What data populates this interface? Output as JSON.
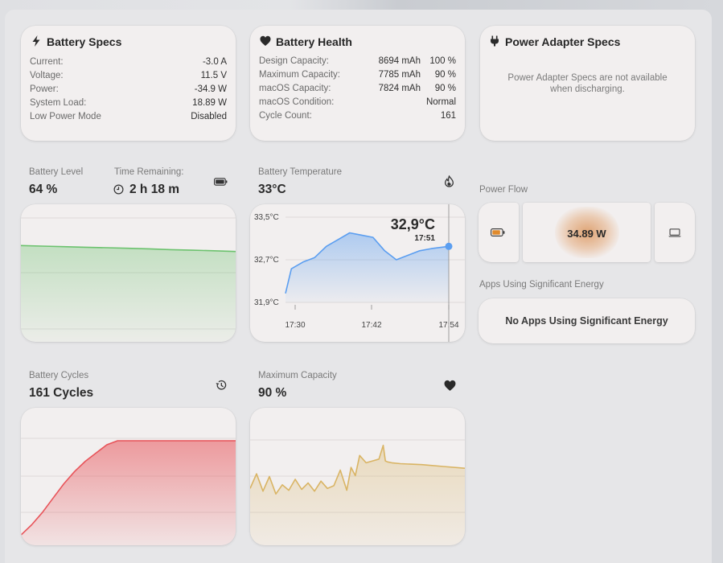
{
  "battery_specs": {
    "title": "Battery Specs",
    "rows": [
      {
        "label": "Current:",
        "value": "-3.0 A"
      },
      {
        "label": "Voltage:",
        "value": "11.5 V"
      },
      {
        "label": "Power:",
        "value": "-34.9 W"
      },
      {
        "label": "System Load:",
        "value": "18.89 W"
      },
      {
        "label": "Low Power Mode",
        "value": "Disabled"
      }
    ]
  },
  "battery_health": {
    "title": "Battery Health",
    "rows": [
      {
        "label": "Design Capacity:",
        "value": "8694 mAh",
        "pct": "100 %"
      },
      {
        "label": "Maximum Capacity:",
        "value": "7785 mAh",
        "pct": "90 %"
      },
      {
        "label": "macOS Capacity:",
        "value": "7824 mAh",
        "pct": "90 %"
      },
      {
        "label": "macOS Condition:",
        "value": "Normal",
        "pct": ""
      },
      {
        "label": "Cycle Count:",
        "value": "161",
        "pct": ""
      }
    ]
  },
  "adapter_specs": {
    "title": "Power Adapter Specs",
    "message_line1": "Power Adapter Specs are not available",
    "message_line2": "when discharging."
  },
  "battery_level": {
    "label": "Battery Level",
    "value": "64 %",
    "time_label": "Time Remaining:",
    "time_value": "2 h 18 m"
  },
  "battery_temperature": {
    "label": "Battery Temperature",
    "value": "33°C",
    "y_ticks": [
      "33,5°C",
      "32,7°C",
      "31,9°C"
    ],
    "x_ticks": [
      "17:30",
      "17:42",
      "17:54"
    ],
    "readout_value": "32,9°C",
    "readout_time": "17:51"
  },
  "power_flow": {
    "label": "Power Flow",
    "value": "34.89 W"
  },
  "apps_energy": {
    "label": "Apps Using Significant Energy",
    "message": "No Apps Using Significant Energy"
  },
  "battery_cycles": {
    "label": "Battery Cycles",
    "value": "161 Cycles"
  },
  "max_capacity": {
    "label": "Maximum Capacity",
    "value": "90 %"
  },
  "colors": {
    "level_line": "#6cc26e",
    "temp_line": "#5b9ef0",
    "cycles_line": "#e8545a",
    "capacity_line": "#d9b464"
  },
  "chart_data": [
    {
      "type": "area",
      "name": "battery-level",
      "x": [
        0,
        10,
        20,
        30,
        40,
        50,
        60,
        70,
        80,
        90,
        100
      ],
      "y": [
        70,
        69.6,
        69.2,
        68.8,
        68.4,
        68.0,
        67.6,
        67.0,
        66.6,
        66.2,
        65.7
      ],
      "ylim": [
        0,
        100
      ]
    },
    {
      "type": "line",
      "name": "battery-temperature",
      "x": [
        "17:26",
        "17:27",
        "17:29",
        "17:31",
        "17:33",
        "17:35",
        "17:37",
        "17:39",
        "17:41",
        "17:43",
        "17:45",
        "17:47",
        "17:49",
        "17:51",
        "17:54"
      ],
      "y": [
        31.9,
        32.45,
        32.6,
        32.7,
        32.95,
        33.1,
        33.25,
        33.2,
        33.15,
        32.85,
        32.65,
        32.75,
        32.85,
        32.9,
        32.95
      ],
      "ylim": [
        31.7,
        33.6
      ]
    },
    {
      "type": "area",
      "name": "battery-cycles",
      "x": [
        0,
        5,
        10,
        15,
        20,
        25,
        30,
        35,
        40,
        45,
        50,
        100
      ],
      "y": [
        115,
        120,
        126,
        133,
        140,
        146,
        151,
        155,
        159,
        161,
        161,
        161
      ],
      "ylim": [
        110,
        170
      ]
    },
    {
      "type": "line",
      "name": "maximum-capacity",
      "x": [
        0,
        3,
        6,
        9,
        12,
        15,
        18,
        21,
        24,
        27,
        30,
        33,
        36,
        39,
        42,
        45,
        47,
        49,
        51,
        54,
        57,
        60,
        62,
        63,
        64,
        66,
        70,
        80,
        90,
        100
      ],
      "y": [
        86.2,
        87.8,
        85.9,
        87.5,
        85.6,
        86.6,
        86.0,
        87.2,
        86.1,
        86.8,
        85.9,
        87.0,
        86.2,
        86.5,
        88.2,
        86.0,
        88.5,
        87.6,
        89.8,
        89.0,
        89.2,
        89.4,
        90.9,
        89.2,
        89.1,
        89.0,
        88.9,
        88.8,
        88.6,
        88.4
      ],
      "ylim": [
        80,
        95
      ]
    }
  ]
}
